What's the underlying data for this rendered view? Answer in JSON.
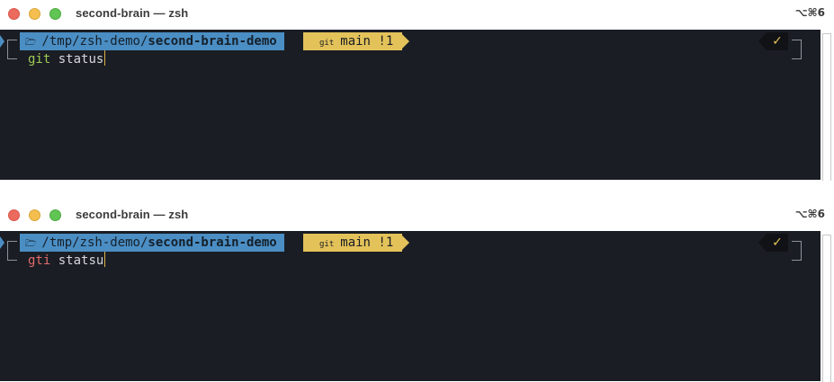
{
  "windows": [
    {
      "title": "second-brain — zsh",
      "shortcut": "⌥⌘6",
      "prompt": {
        "dir_icon": "folder-icon",
        "dir_prefix": "/tmp/zsh-demo/",
        "dir_name": "second-brain-demo",
        "git_icon": "git-branch-icon",
        "branch": "main !1",
        "status_mark": "✓"
      },
      "command": {
        "program": "git",
        "args": " status",
        "valid": true
      }
    },
    {
      "title": "second-brain — zsh",
      "shortcut": "⌥⌘6",
      "prompt": {
        "dir_icon": "folder-icon",
        "dir_prefix": "/tmp/zsh-demo/",
        "dir_name": "second-brain-demo",
        "git_icon": "git-branch-icon",
        "branch": "main !1",
        "status_mark": "✓"
      },
      "command": {
        "program": "gti",
        "args": " statsu",
        "valid": false
      }
    }
  ],
  "colors": {
    "terminal_bg": "#1a1d24",
    "dir_segment": "#4b8ec4",
    "git_segment": "#e3c25a",
    "valid_command": "#9fca56",
    "invalid_command": "#e06c6c"
  }
}
